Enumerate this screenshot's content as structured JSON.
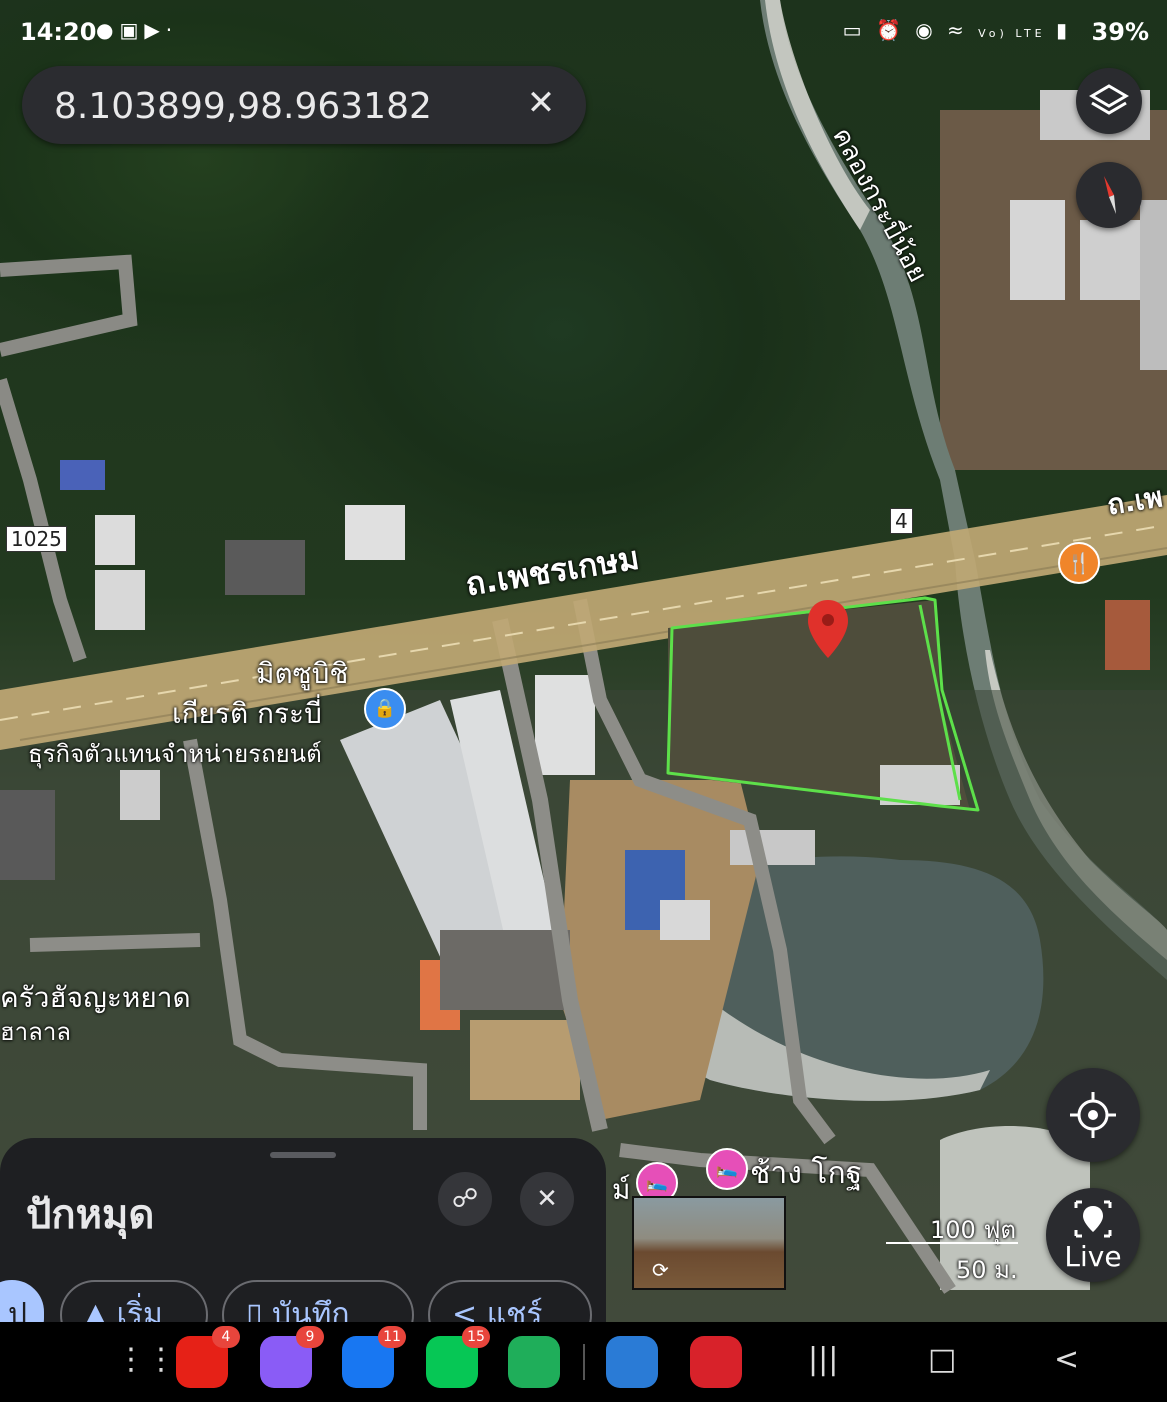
{
  "status_bar": {
    "time": "14:20",
    "left_icons": [
      "messenger-icon",
      "gallery-icon",
      "youtube-icon",
      "dot-icon"
    ],
    "right_icons_text": "Vo) LTE",
    "battery": "39%"
  },
  "search": {
    "query": "8.103899,98.963182",
    "clear_icon": "close-icon"
  },
  "map_labels": {
    "canal": "คลองกระบี่น้อย",
    "road_main": "ถ.เพชรเกษม",
    "road_main_right": "ถ.เพ",
    "route_1025": "1025",
    "route_4": "4",
    "dealer_name_1": "มิตซูบิชิ",
    "dealer_name_2": "เกียรติ กระบี่",
    "dealer_desc": "ธุรกิจตัวแทนจำหน่ายรถยนต์",
    "restaurant_1": "ครัวฮัจญะหยาด",
    "restaurant_2": "ฮาลาล",
    "hotel": "ช้าง โกฐ",
    "hotel_partial": "ม์"
  },
  "scale": {
    "feet": "100 ฟุต",
    "meters": "50 ม."
  },
  "live_label": "Live",
  "bottom_sheet": {
    "title": "ปักหมุด",
    "chips": [
      "ป",
      "เริ่ม",
      "บันทึก",
      "แชร์"
    ]
  },
  "dock": {
    "apps": [
      {
        "name": "youtube",
        "badge": "4",
        "color": "#e62117"
      },
      {
        "name": "messenger",
        "badge": "9",
        "color": "#8a5cf6"
      },
      {
        "name": "facebook",
        "badge": "11",
        "color": "#1877f2"
      },
      {
        "name": "line",
        "badge": "15",
        "color": "#06c755"
      },
      {
        "name": "call-app",
        "badge": "",
        "color": "#1fae5a"
      },
      {
        "name": "weather-app",
        "badge": "",
        "color": "#2a7bd6"
      },
      {
        "name": "cloud-app",
        "badge": "",
        "color": "#d8222a"
      }
    ]
  },
  "colors": {
    "parcel_outline": "#5de04a",
    "pin": "#e0312b",
    "road": "#bfa874",
    "water": "#5f6f66"
  }
}
